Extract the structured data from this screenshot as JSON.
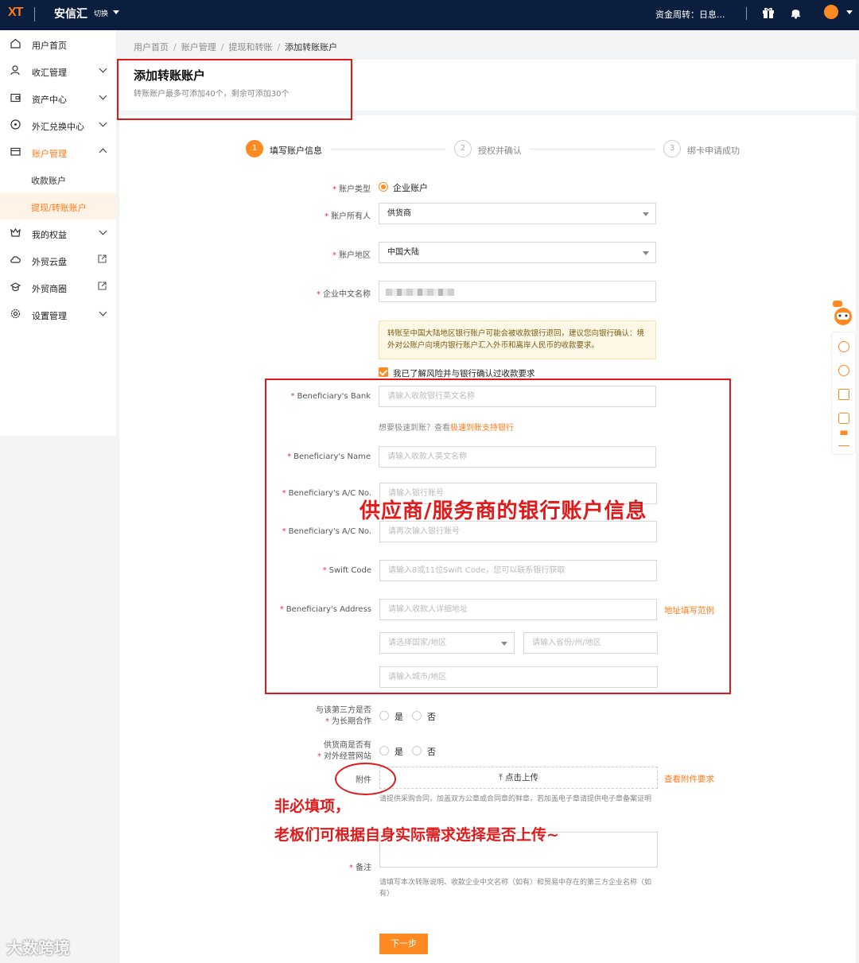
{
  "topbar": {
    "logo": "XT",
    "brand": "安信汇",
    "switch": "切换",
    "funds": "资金周转：日息..."
  },
  "sidebar": {
    "items": [
      {
        "label": "用户首页"
      },
      {
        "label": "收汇管理"
      },
      {
        "label": "资产中心"
      },
      {
        "label": "外汇兑换中心"
      },
      {
        "label": "账户管理"
      },
      {
        "label": "收款账户"
      },
      {
        "label": "提现/转账账户"
      },
      {
        "label": "我的权益"
      },
      {
        "label": "外贸云盘"
      },
      {
        "label": "外贸商圈"
      },
      {
        "label": "设置管理"
      }
    ]
  },
  "breadcrumb": [
    "用户首页",
    "账户管理",
    "提现和转账",
    "添加转账账户"
  ],
  "header": {
    "title": "添加转账账户",
    "subtitle": "转账账户最多可添加40个，剩余可添加30个"
  },
  "steps": [
    {
      "num": "1",
      "label": "填写账户信息"
    },
    {
      "num": "2",
      "label": "授权并确认"
    },
    {
      "num": "3",
      "label": "绑卡申请成功"
    }
  ],
  "form": {
    "account_type_label": "账户类型",
    "account_type_value": "企业账户",
    "owner_label": "账户所有人",
    "owner_value": "供货商",
    "region_label": "账户地区",
    "region_value": "中国大陆",
    "company_label": "企业中文名称",
    "notice": "转账至中国大陆地区银行账户可能会被收款银行退回，建议您向银行确认：境外对公账户向境内银行账户汇入外币和离岸人民币的收款要求。",
    "confirm_check": "我已了解风险并与银行确认过收款要求",
    "bank_label": "Beneficiary's Bank",
    "bank_placeholder": "请输入收款银行英文名称",
    "fast_hint": "想要极速到账？查看",
    "fast_link": "极速到账支持银行",
    "name_label": "Beneficiary's Name",
    "name_placeholder": "请输入收款人英文名称",
    "acno_label": "Beneficiary's A/C No.",
    "acno_placeholder": "请输入银行账号",
    "acno2_label": "Beneficiary's A/C No.",
    "acno2_placeholder": "请再次输入银行账号",
    "swift_label": "Swift Code",
    "swift_placeholder": "请输入8或11位Swift Code，您可以联系银行获取",
    "address_label": "Beneficiary's Address",
    "address_placeholder": "请输入收款人详细地址",
    "address_example": "地址填写范例",
    "country_placeholder": "请选择国家/地区",
    "province_placeholder": "请输入省份/州/地区",
    "city_placeholder": "请输入城市/地区",
    "longterm_label_1": "与该第三方是否",
    "longterm_label_2": "为长期合作",
    "site_label_1": "供货商是否有",
    "site_label_2": "对外经营网站",
    "yes": "是",
    "no": "否",
    "attachment_label": "附件",
    "upload_label": "点击上传",
    "attachment_req": "查看附件要求",
    "attachment_hint": "请提供采购合同，加盖双方公章或合同章的鲜章，若加盖电子章请提供电子章备案证明",
    "remark_label": "备注",
    "remark_hint": "请填写本次转账说明、收款企业中文名称（如有）和贸易中存在的第三方企业名称（如有）",
    "next_button": "下一步"
  },
  "annotations": {
    "bank_box": "供应商/服务商的银行账户信息",
    "optional_1": "非必填项，",
    "optional_2": "老板们可根据自身实际需求选择是否上传~"
  },
  "watermark": "大数跨境",
  "colors": {
    "accent": "#ff8a22",
    "topbar": "#0c1e3e",
    "annotation": "#e01a1a"
  }
}
